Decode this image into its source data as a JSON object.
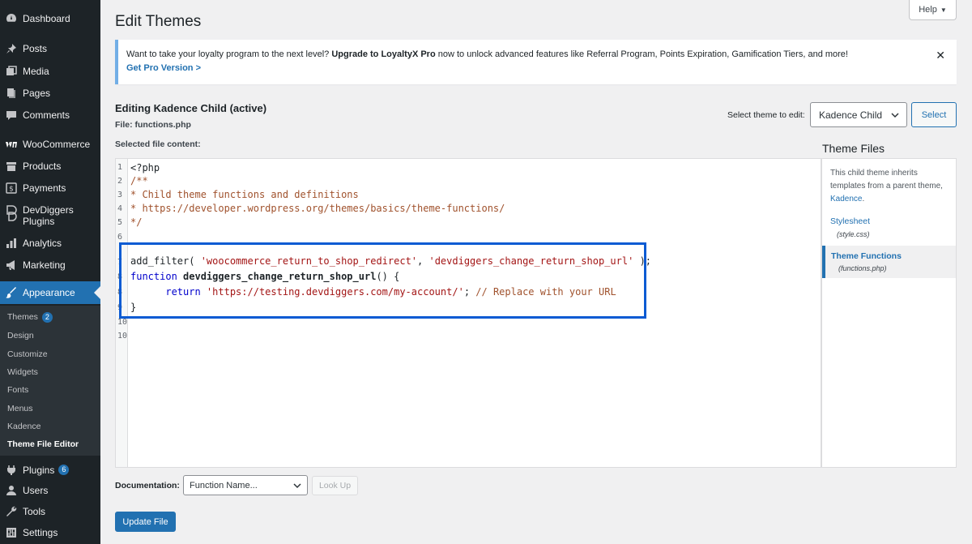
{
  "sidebar": {
    "items": [
      {
        "key": "dashboard",
        "label": "Dashboard",
        "icon": "dashboard-icon"
      },
      {
        "key": "posts",
        "label": "Posts",
        "icon": "pin-icon"
      },
      {
        "key": "media",
        "label": "Media",
        "icon": "media-icon"
      },
      {
        "key": "pages",
        "label": "Pages",
        "icon": "pages-icon"
      },
      {
        "key": "comments",
        "label": "Comments",
        "icon": "comment-icon"
      },
      {
        "key": "woocommerce",
        "label": "WooCommerce",
        "icon": "woo-icon"
      },
      {
        "key": "products",
        "label": "Products",
        "icon": "box-icon"
      },
      {
        "key": "payments",
        "label": "Payments",
        "icon": "dollar-icon"
      },
      {
        "key": "devdiggers",
        "label": "DevDiggers Plugins",
        "icon": "devdiggers-icon"
      },
      {
        "key": "analytics",
        "label": "Analytics",
        "icon": "bar-chart-icon"
      },
      {
        "key": "marketing",
        "label": "Marketing",
        "icon": "megaphone-icon"
      },
      {
        "key": "appearance",
        "label": "Appearance",
        "icon": "brush-icon"
      },
      {
        "key": "plugins",
        "label": "Plugins",
        "icon": "plug-icon",
        "badge": "6"
      },
      {
        "key": "users",
        "label": "Users",
        "icon": "user-icon"
      },
      {
        "key": "tools",
        "label": "Tools",
        "icon": "wrench-icon"
      },
      {
        "key": "settings",
        "label": "Settings",
        "icon": "sliders-icon"
      }
    ],
    "submenu": [
      {
        "label": "Themes",
        "badge": "2"
      },
      {
        "label": "Design"
      },
      {
        "label": "Customize"
      },
      {
        "label": "Widgets"
      },
      {
        "label": "Fonts"
      },
      {
        "label": "Menus"
      },
      {
        "label": "Kadence"
      },
      {
        "label": "Theme File Editor",
        "current": true
      }
    ]
  },
  "header": {
    "title": "Edit Themes",
    "help_label": "Help"
  },
  "notice": {
    "text_pre": "Want to take your loyalty program to the next level? ",
    "text_bold": "Upgrade to LoyaltyX Pro",
    "text_post": " now to unlock advanced features like Referral Program, Points Expiration, Gamification Tiers, and more!",
    "link": "Get Pro Version >",
    "close": "✕"
  },
  "editor": {
    "editing_title": "Editing Kadence Child (active)",
    "file_label": "File: functions.php",
    "selected_label": "Selected file content:",
    "select_theme_label": "Select theme to edit:",
    "theme_selected": "Kadence Child",
    "select_button": "Select",
    "line_numbers": [
      "1",
      "2",
      "3",
      "4",
      "5",
      "6",
      "7",
      "8",
      "8",
      "9",
      "10",
      "10"
    ],
    "lines": {
      "l1": "<?php",
      "l2": "/**",
      "l3": "* Child theme functions and definitions",
      "l4": "* https://developer.wordpress.org/themes/basics/theme-functions/",
      "l5": "*/",
      "l7_a": "add_filter( ",
      "l7_b": "'woocommerce_return_to_shop_redirect'",
      "l7_c": ", ",
      "l7_d": "'devdiggers_change_return_shop_url'",
      "l7_e": " );",
      "l8_kw": "function",
      "l8_fn": " devdiggers_change_return_shop_url",
      "l8_rest": "() {",
      "l9_kw": "      return ",
      "l9_str": "'https://testing.devdiggers.com/my-account/'",
      "l9_semi": ";",
      "l9_comment": " // Replace with your URL",
      "l10": "}"
    }
  },
  "theme_files": {
    "title": "Theme Files",
    "desc_pre": "This child theme inherits templates from a parent theme, ",
    "desc_link": "Kadence",
    "desc_post": ".",
    "files": [
      {
        "name": "Stylesheet",
        "file": "(style.css)"
      },
      {
        "name": "Theme Functions",
        "file": "(functions.php)",
        "current": true
      }
    ]
  },
  "footer": {
    "doc_label": "Documentation:",
    "doc_select": "Function Name...",
    "lookup_button": "Look Up",
    "update_button": "Update File"
  }
}
